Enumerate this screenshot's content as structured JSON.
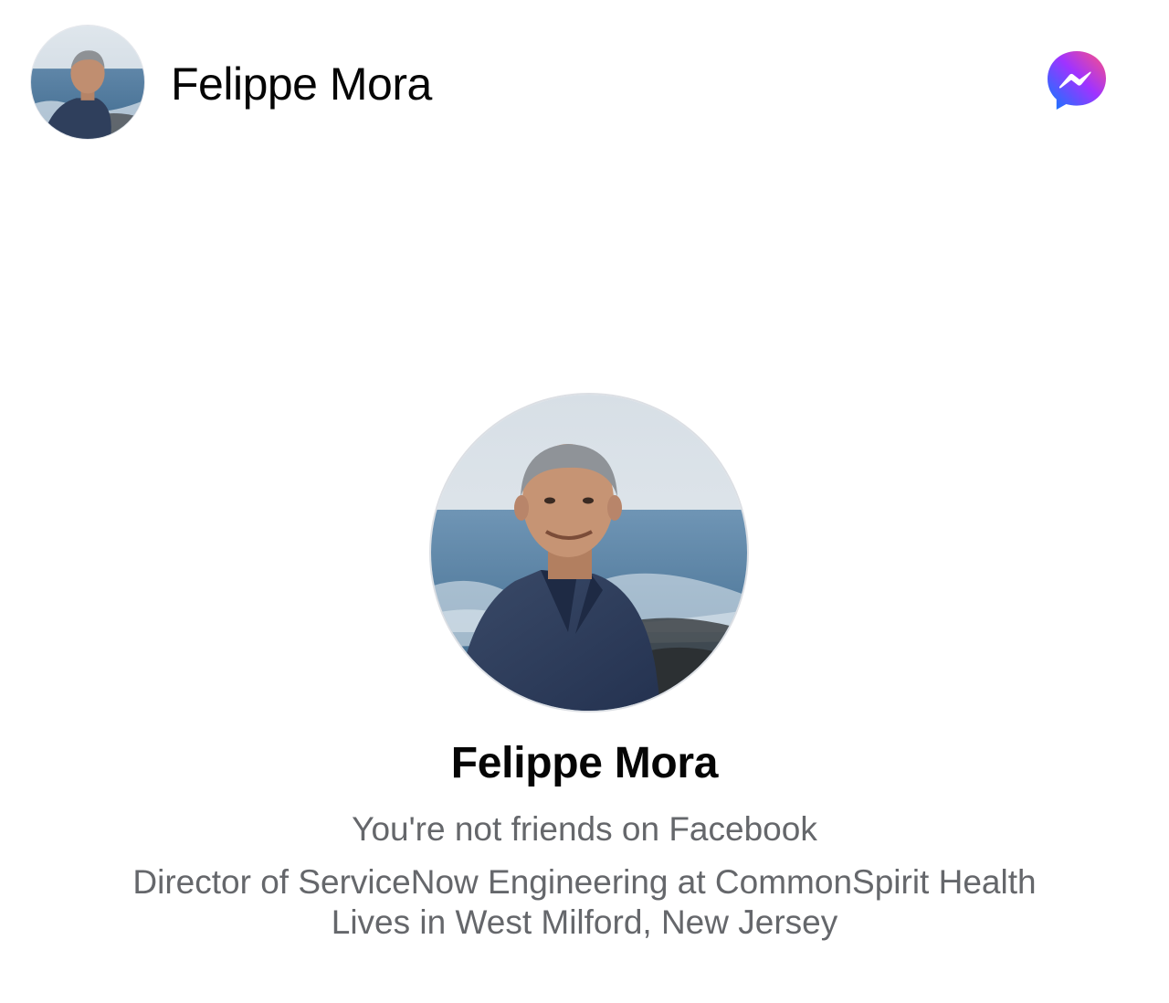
{
  "header": {
    "name": "Felippe Mora",
    "avatar_icon": "profile-photo",
    "action_icon": "messenger-icon"
  },
  "intro": {
    "name": "Felippe Mora",
    "friendship_status": "You're not friends on Facebook",
    "work": "Director of ServiceNow Engineering at CommonSpirit Health",
    "lives_in": "Lives in West Milford, New Jersey"
  },
  "colors": {
    "primary_text": "#050505",
    "secondary_text": "#65676b",
    "messenger_gradient_start": "#0a7cff",
    "messenger_gradient_mid": "#a033ff",
    "messenger_gradient_end": "#ff5280"
  }
}
